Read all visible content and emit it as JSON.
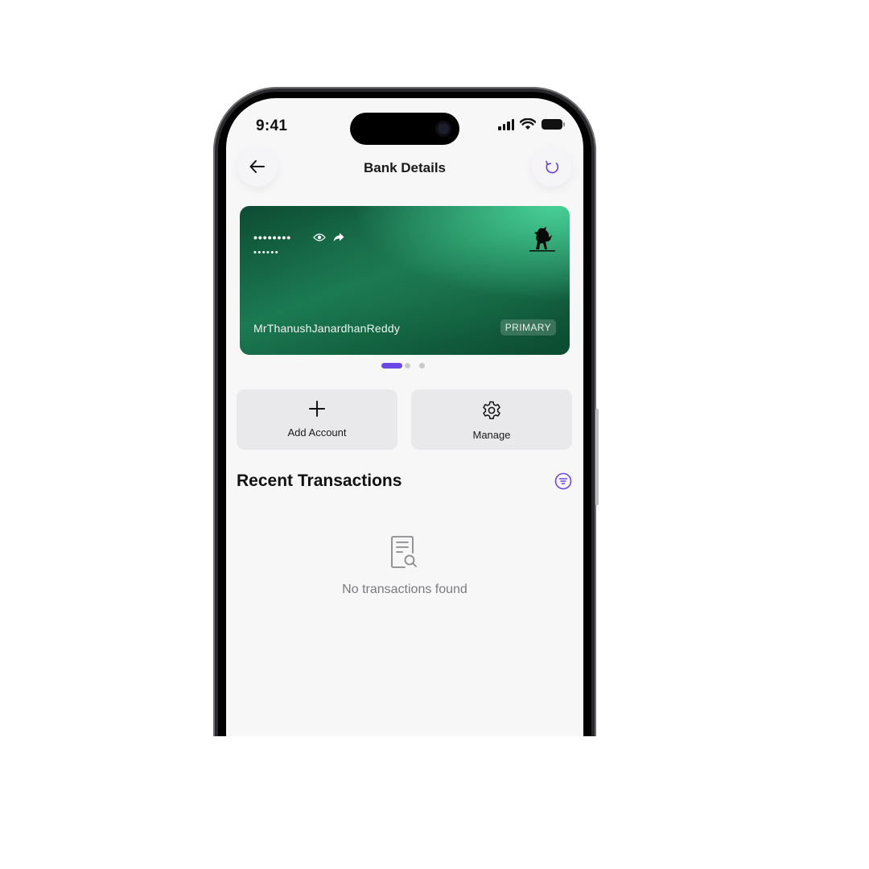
{
  "status_bar": {
    "time": "9:41"
  },
  "header": {
    "title": "Bank Details",
    "back_icon": "arrow-left-icon",
    "refresh_icon": "refresh-icon"
  },
  "card": {
    "account_number_masked": "••••••••",
    "sort_code_masked": "••••••",
    "holder_name": "MrThanushJanardhanReddy",
    "badge": "PRIMARY",
    "colors": {
      "gradient_dark": "#0d4c33",
      "gradient_light": "#47cf96"
    }
  },
  "pager": {
    "total": 3,
    "active_index": 0,
    "accent": "#6a48e6"
  },
  "actions": {
    "add_label": "Add Account",
    "manage_label": "Manage"
  },
  "transactions": {
    "title": "Recent Transactions",
    "empty_message": "No transactions found",
    "filter_icon": "filter-icon"
  },
  "accent_color": "#6a48e6"
}
